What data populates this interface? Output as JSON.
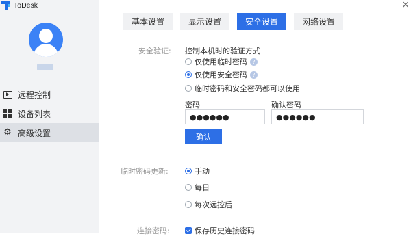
{
  "app": {
    "name": "ToDesk",
    "close_glyph": "×"
  },
  "sidebar": {
    "items": [
      {
        "label": "远程控制",
        "icon": "remote-control-icon"
      },
      {
        "label": "设备列表",
        "icon": "device-grid-icon"
      },
      {
        "label": "高级设置",
        "icon": "gear-icon",
        "active": true
      }
    ]
  },
  "tabs": [
    {
      "label": "基本设置"
    },
    {
      "label": "显示设置"
    },
    {
      "label": "安全设置",
      "active": true
    },
    {
      "label": "网络设置"
    }
  ],
  "security": {
    "label": "安全验证:",
    "description": "控制本机时的验证方式",
    "options": [
      {
        "label": "仅使用临时密码",
        "checked": false,
        "help": "?"
      },
      {
        "label": "仅使用安全密码",
        "checked": true,
        "help": "?"
      },
      {
        "label": "临时密码和安全密码都可以使用",
        "checked": false
      }
    ],
    "password_label": "密码",
    "password_value": "●●●●●●",
    "confirm_label": "确认密码",
    "confirm_value": "●●●●●●",
    "confirm_button": "确认"
  },
  "temp_update": {
    "label": "临时密码更新:",
    "options": [
      {
        "label": "手动",
        "checked": true
      },
      {
        "label": "每日",
        "checked": false
      },
      {
        "label": "每次远控后",
        "checked": false
      }
    ]
  },
  "connect_password": {
    "label": "连接密码:",
    "checkbox_label": "保存历史连接密码",
    "checked": true
  },
  "colors": {
    "accent": "#2d6fe6",
    "avatar": "#3b82f6",
    "sidebar_bg": "#f2f3f5"
  }
}
